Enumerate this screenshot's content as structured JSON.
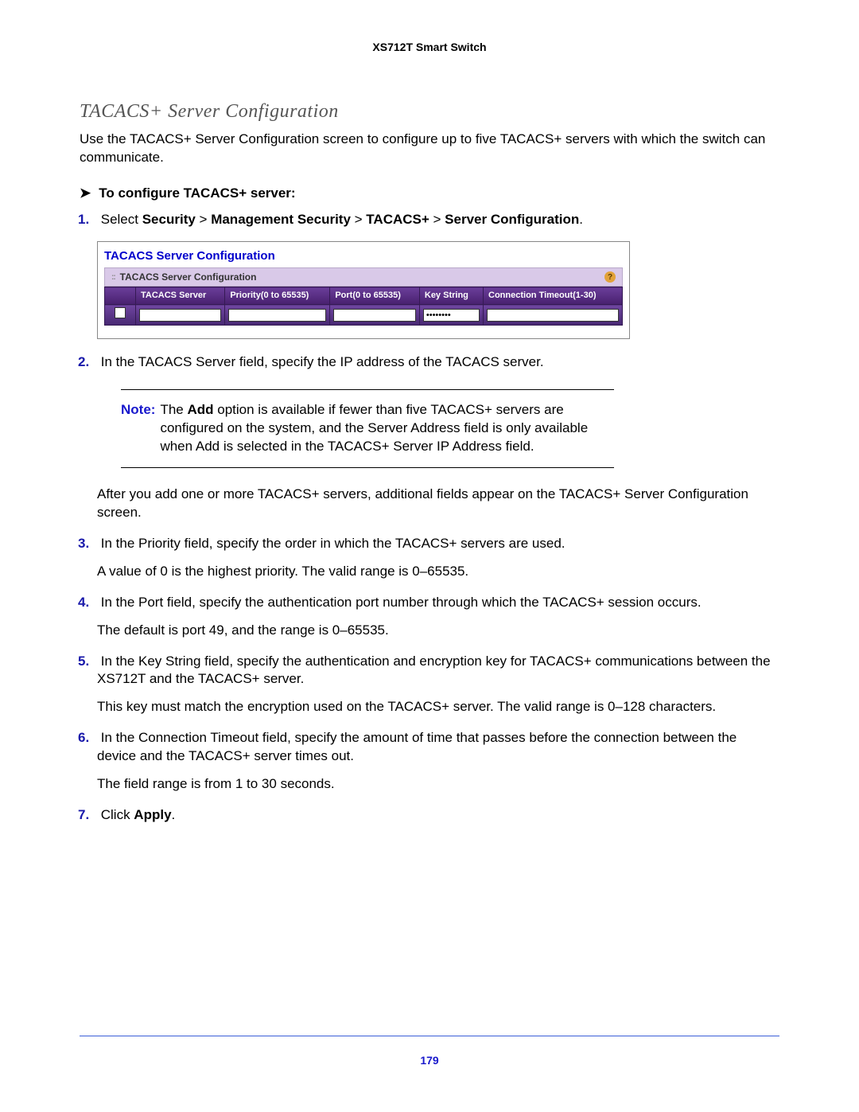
{
  "header": "XS712T Smart Switch",
  "section_title": "TACACS+  Server Configuration",
  "intro": "Use the TACACS+ Server Configuration screen to configure up to five TACACS+ servers with which the switch can communicate.",
  "proc_heading": "To configure TACACS+ server:",
  "step1": {
    "prefix": "Select ",
    "path": [
      "Security",
      "Management Security",
      "TACACS+",
      "Server Configuration"
    ],
    "sep": " > "
  },
  "panel": {
    "title": "TACACS Server Configuration",
    "subtitle": "TACACS Server Configuration",
    "columns": [
      "TACACS Server",
      "Priority(0 to 65535)",
      "Port(0 to 65535)",
      "Key String",
      "Connection Timeout(1-30)"
    ],
    "row": {
      "server": "",
      "priority": "",
      "port": "",
      "key": "••••••••",
      "timeout": ""
    }
  },
  "step2": "In the TACACS Server field, specify the IP address of the TACACS server.",
  "note_label": "Note:",
  "note_text_lead": "The ",
  "note_text_bold": "Add",
  "note_text_rest": " option is available if fewer than five TACACS+ servers are configured on the system, and the Server Address field is only available when Add is selected in the TACACS+ Server IP Address field.",
  "after_note": "After you add one or more TACACS+ servers, additional fields appear on the TACACS+ Server Configuration screen.",
  "step3": "In the Priority field, specify the order in which the TACACS+ servers are used.",
  "step3_sub": "A value of 0 is the highest priority. The valid range is 0–65535.",
  "step4": "In the Port field, specify the authentication port number through which the TACACS+ session occurs.",
  "step4_sub": "The default is port 49, and the range is 0–65535.",
  "step5": "In the Key String field, specify the authentication and encryption key for TACACS+ communications between the XS712T and the TACACS+ server.",
  "step5_sub": "This key must match the encryption used on the TACACS+ server. The valid range is 0–128 characters.",
  "step6": "In the Connection Timeout field, specify the amount of time that passes before the connection between the device and the TACACS+ server times out.",
  "step6_sub": "The field range is from 1 to 30 seconds.",
  "step7_pre": "Click ",
  "step7_bold": "Apply",
  "step7_post": ".",
  "page_num": "179"
}
